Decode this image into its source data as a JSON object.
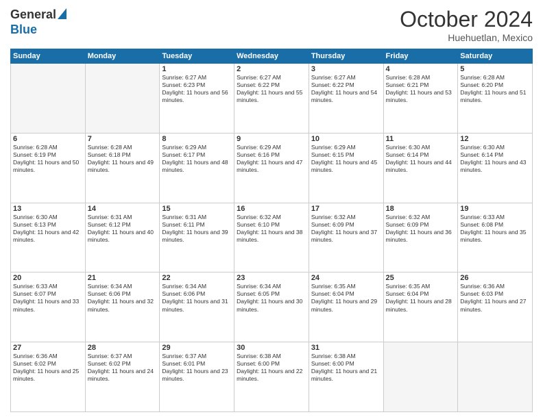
{
  "header": {
    "logo_general": "General",
    "logo_blue": "Blue",
    "month_title": "October 2024",
    "location": "Huehuetlan, Mexico"
  },
  "days_of_week": [
    "Sunday",
    "Monday",
    "Tuesday",
    "Wednesday",
    "Thursday",
    "Friday",
    "Saturday"
  ],
  "weeks": [
    [
      {
        "day": "",
        "empty": true
      },
      {
        "day": "",
        "empty": true
      },
      {
        "day": "1",
        "sunrise": "6:27 AM",
        "sunset": "6:23 PM",
        "daylight": "11 hours and 56 minutes."
      },
      {
        "day": "2",
        "sunrise": "6:27 AM",
        "sunset": "6:22 PM",
        "daylight": "11 hours and 55 minutes."
      },
      {
        "day": "3",
        "sunrise": "6:27 AM",
        "sunset": "6:22 PM",
        "daylight": "11 hours and 54 minutes."
      },
      {
        "day": "4",
        "sunrise": "6:28 AM",
        "sunset": "6:21 PM",
        "daylight": "11 hours and 53 minutes."
      },
      {
        "day": "5",
        "sunrise": "6:28 AM",
        "sunset": "6:20 PM",
        "daylight": "11 hours and 51 minutes."
      }
    ],
    [
      {
        "day": "6",
        "sunrise": "6:28 AM",
        "sunset": "6:19 PM",
        "daylight": "11 hours and 50 minutes."
      },
      {
        "day": "7",
        "sunrise": "6:28 AM",
        "sunset": "6:18 PM",
        "daylight": "11 hours and 49 minutes."
      },
      {
        "day": "8",
        "sunrise": "6:29 AM",
        "sunset": "6:17 PM",
        "daylight": "11 hours and 48 minutes."
      },
      {
        "day": "9",
        "sunrise": "6:29 AM",
        "sunset": "6:16 PM",
        "daylight": "11 hours and 47 minutes."
      },
      {
        "day": "10",
        "sunrise": "6:29 AM",
        "sunset": "6:15 PM",
        "daylight": "11 hours and 45 minutes."
      },
      {
        "day": "11",
        "sunrise": "6:30 AM",
        "sunset": "6:14 PM",
        "daylight": "11 hours and 44 minutes."
      },
      {
        "day": "12",
        "sunrise": "6:30 AM",
        "sunset": "6:14 PM",
        "daylight": "11 hours and 43 minutes."
      }
    ],
    [
      {
        "day": "13",
        "sunrise": "6:30 AM",
        "sunset": "6:13 PM",
        "daylight": "11 hours and 42 minutes."
      },
      {
        "day": "14",
        "sunrise": "6:31 AM",
        "sunset": "6:12 PM",
        "daylight": "11 hours and 40 minutes."
      },
      {
        "day": "15",
        "sunrise": "6:31 AM",
        "sunset": "6:11 PM",
        "daylight": "11 hours and 39 minutes."
      },
      {
        "day": "16",
        "sunrise": "6:32 AM",
        "sunset": "6:10 PM",
        "daylight": "11 hours and 38 minutes."
      },
      {
        "day": "17",
        "sunrise": "6:32 AM",
        "sunset": "6:09 PM",
        "daylight": "11 hours and 37 minutes."
      },
      {
        "day": "18",
        "sunrise": "6:32 AM",
        "sunset": "6:09 PM",
        "daylight": "11 hours and 36 minutes."
      },
      {
        "day": "19",
        "sunrise": "6:33 AM",
        "sunset": "6:08 PM",
        "daylight": "11 hours and 35 minutes."
      }
    ],
    [
      {
        "day": "20",
        "sunrise": "6:33 AM",
        "sunset": "6:07 PM",
        "daylight": "11 hours and 33 minutes."
      },
      {
        "day": "21",
        "sunrise": "6:34 AM",
        "sunset": "6:06 PM",
        "daylight": "11 hours and 32 minutes."
      },
      {
        "day": "22",
        "sunrise": "6:34 AM",
        "sunset": "6:06 PM",
        "daylight": "11 hours and 31 minutes."
      },
      {
        "day": "23",
        "sunrise": "6:34 AM",
        "sunset": "6:05 PM",
        "daylight": "11 hours and 30 minutes."
      },
      {
        "day": "24",
        "sunrise": "6:35 AM",
        "sunset": "6:04 PM",
        "daylight": "11 hours and 29 minutes."
      },
      {
        "day": "25",
        "sunrise": "6:35 AM",
        "sunset": "6:04 PM",
        "daylight": "11 hours and 28 minutes."
      },
      {
        "day": "26",
        "sunrise": "6:36 AM",
        "sunset": "6:03 PM",
        "daylight": "11 hours and 27 minutes."
      }
    ],
    [
      {
        "day": "27",
        "sunrise": "6:36 AM",
        "sunset": "6:02 PM",
        "daylight": "11 hours and 25 minutes."
      },
      {
        "day": "28",
        "sunrise": "6:37 AM",
        "sunset": "6:02 PM",
        "daylight": "11 hours and 24 minutes."
      },
      {
        "day": "29",
        "sunrise": "6:37 AM",
        "sunset": "6:01 PM",
        "daylight": "11 hours and 23 minutes."
      },
      {
        "day": "30",
        "sunrise": "6:38 AM",
        "sunset": "6:00 PM",
        "daylight": "11 hours and 22 minutes."
      },
      {
        "day": "31",
        "sunrise": "6:38 AM",
        "sunset": "6:00 PM",
        "daylight": "11 hours and 21 minutes."
      },
      {
        "day": "",
        "empty": true
      },
      {
        "day": "",
        "empty": true
      }
    ]
  ]
}
